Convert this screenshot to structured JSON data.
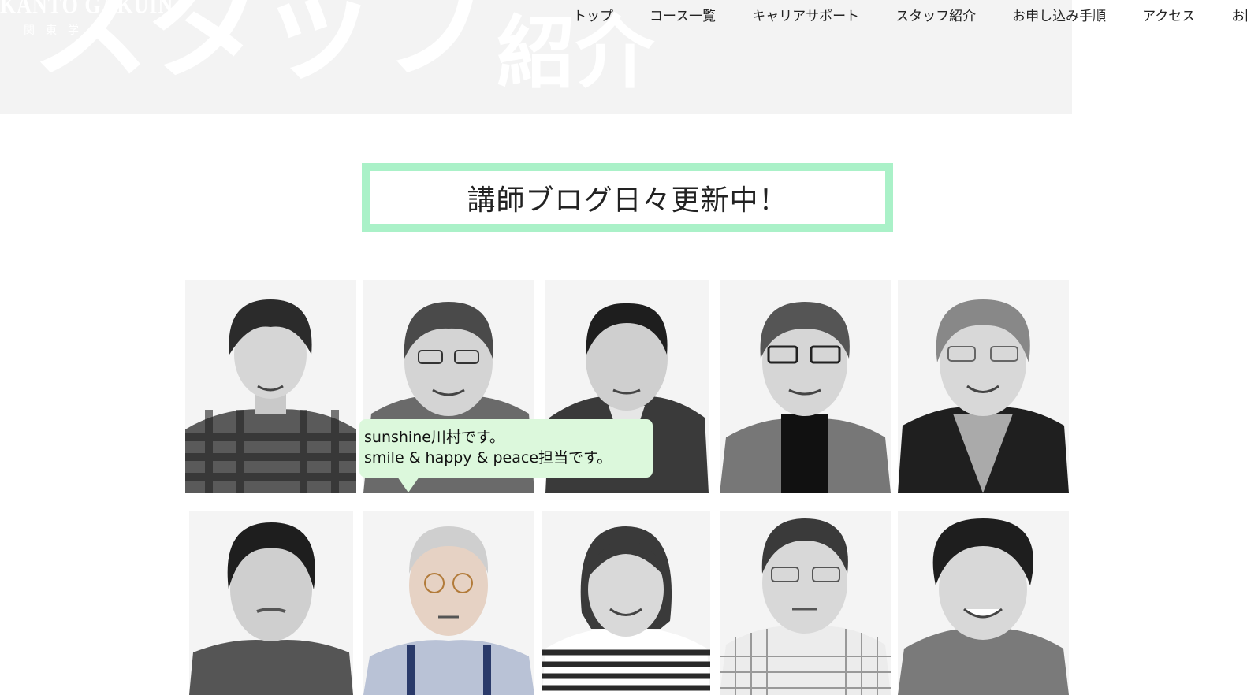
{
  "hero": {
    "big_text": "スタッフ",
    "small_text": "紹介",
    "logo_text": "KANTO GAKUIN",
    "logo_kanji": "関東学"
  },
  "nav": {
    "items": [
      "トップ",
      "コース一覧",
      "キャリアサポート",
      "スタッフ紹介",
      "お申し込み手順",
      "アクセス",
      "お問"
    ]
  },
  "blog_banner": {
    "label": "講師ブログ日々更新中！",
    "border_color": "#aaf1c8"
  },
  "staff": {
    "row1": [
      "staff-1",
      "staff-2",
      "staff-3",
      "staff-4",
      "staff-5"
    ],
    "row2": [
      "staff-6",
      "staff-7",
      "staff-8",
      "staff-9",
      "staff-10"
    ]
  },
  "bubble": {
    "line1": "sunshine川村です。",
    "line2": "smile & happy & peace担当です。",
    "color": "#dcf8dc"
  }
}
